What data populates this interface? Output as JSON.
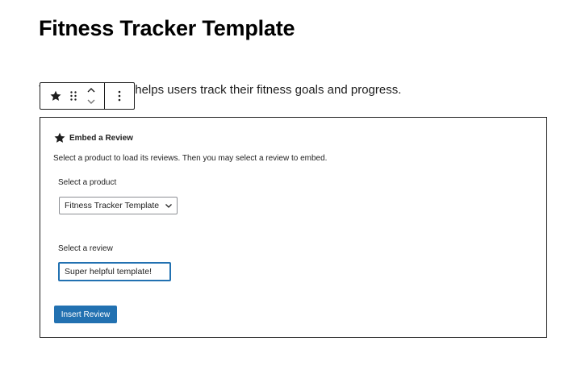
{
  "page": {
    "title": "Fitness Tracker Template",
    "paragraph": "This spreadsheet helps users track their fitness goals and progress."
  },
  "toolbar": {
    "block_icon": "star-icon",
    "drag_icon": "drag-handle-icon",
    "move_up_icon": "chevron-up-icon",
    "move_down_icon": "chevron-down-icon",
    "options_icon": "more-vertical-icon"
  },
  "embed_review": {
    "icon": "star-icon",
    "title": "Embed a Review",
    "instructions": "Select a product to load its reviews. Then you may select a review to embed.",
    "product_label": "Select a product",
    "product_selected": "Fitness Tracker Template",
    "review_label": "Select a review",
    "review_value": "Super helpful template!",
    "insert_button": "Insert Review"
  },
  "colors": {
    "accent": "#2271b1",
    "text": "#1e1e1e",
    "border": "#1e1e1e"
  }
}
